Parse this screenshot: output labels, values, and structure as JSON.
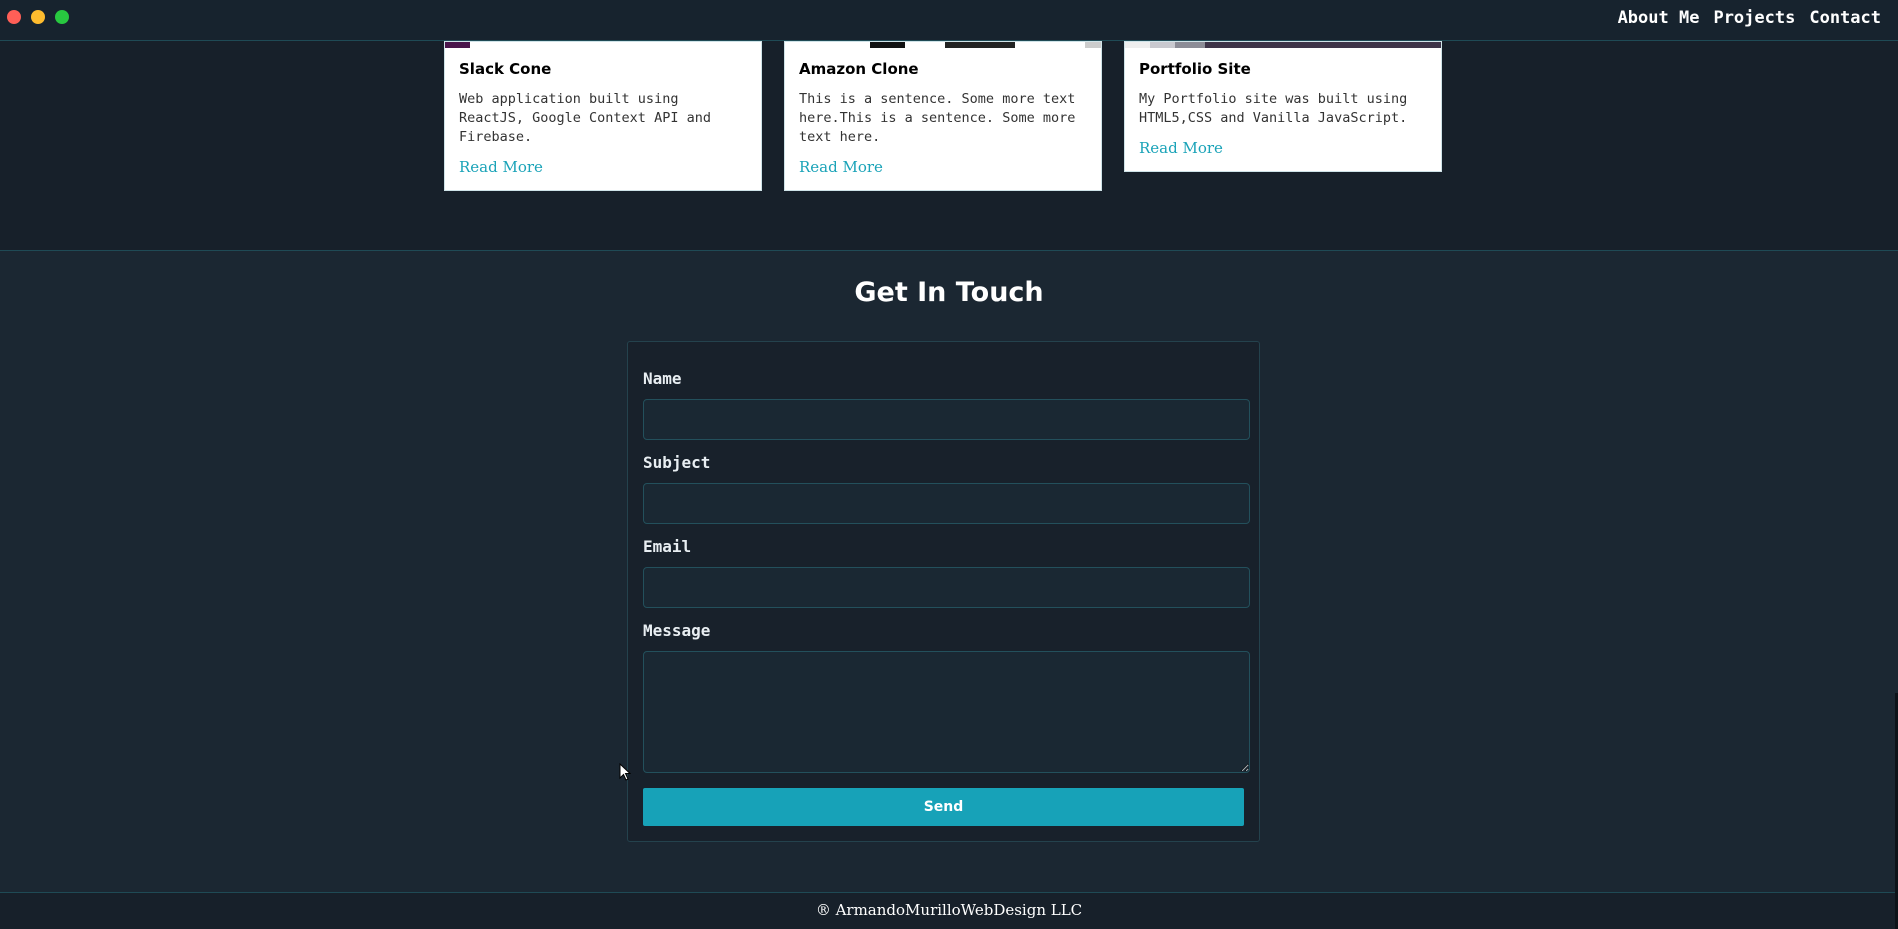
{
  "nav": {
    "items": [
      "About Me",
      "Projects",
      "Contact"
    ]
  },
  "projects": [
    {
      "title": "Slack Cone",
      "description": "Web application built using ReactJS, Google Context API and Firebase.",
      "link": "Read More"
    },
    {
      "title": "Amazon Clone",
      "description": "This is a sentence. Some more text here.This is a sentence. Some more text here.",
      "link": "Read More"
    },
    {
      "title": "Portfolio Site",
      "description": "My Portfolio site was built using HTML5,CSS and Vanilla JavaScript.",
      "link": "Read More"
    }
  ],
  "contact": {
    "heading": "Get In Touch",
    "fields": {
      "name_label": "Name",
      "subject_label": "Subject",
      "email_label": "Email",
      "message_label": "Message"
    },
    "send_label": "Send"
  },
  "footer": {
    "text": "® ArmandoMurilloWebDesign LLC"
  },
  "colors": {
    "accent": "#17a2b8",
    "link": "#1aa3b8",
    "background": "#1b2732",
    "window_close": "#ff5f57",
    "window_minimize": "#febc2e",
    "window_maximize": "#28c840"
  }
}
